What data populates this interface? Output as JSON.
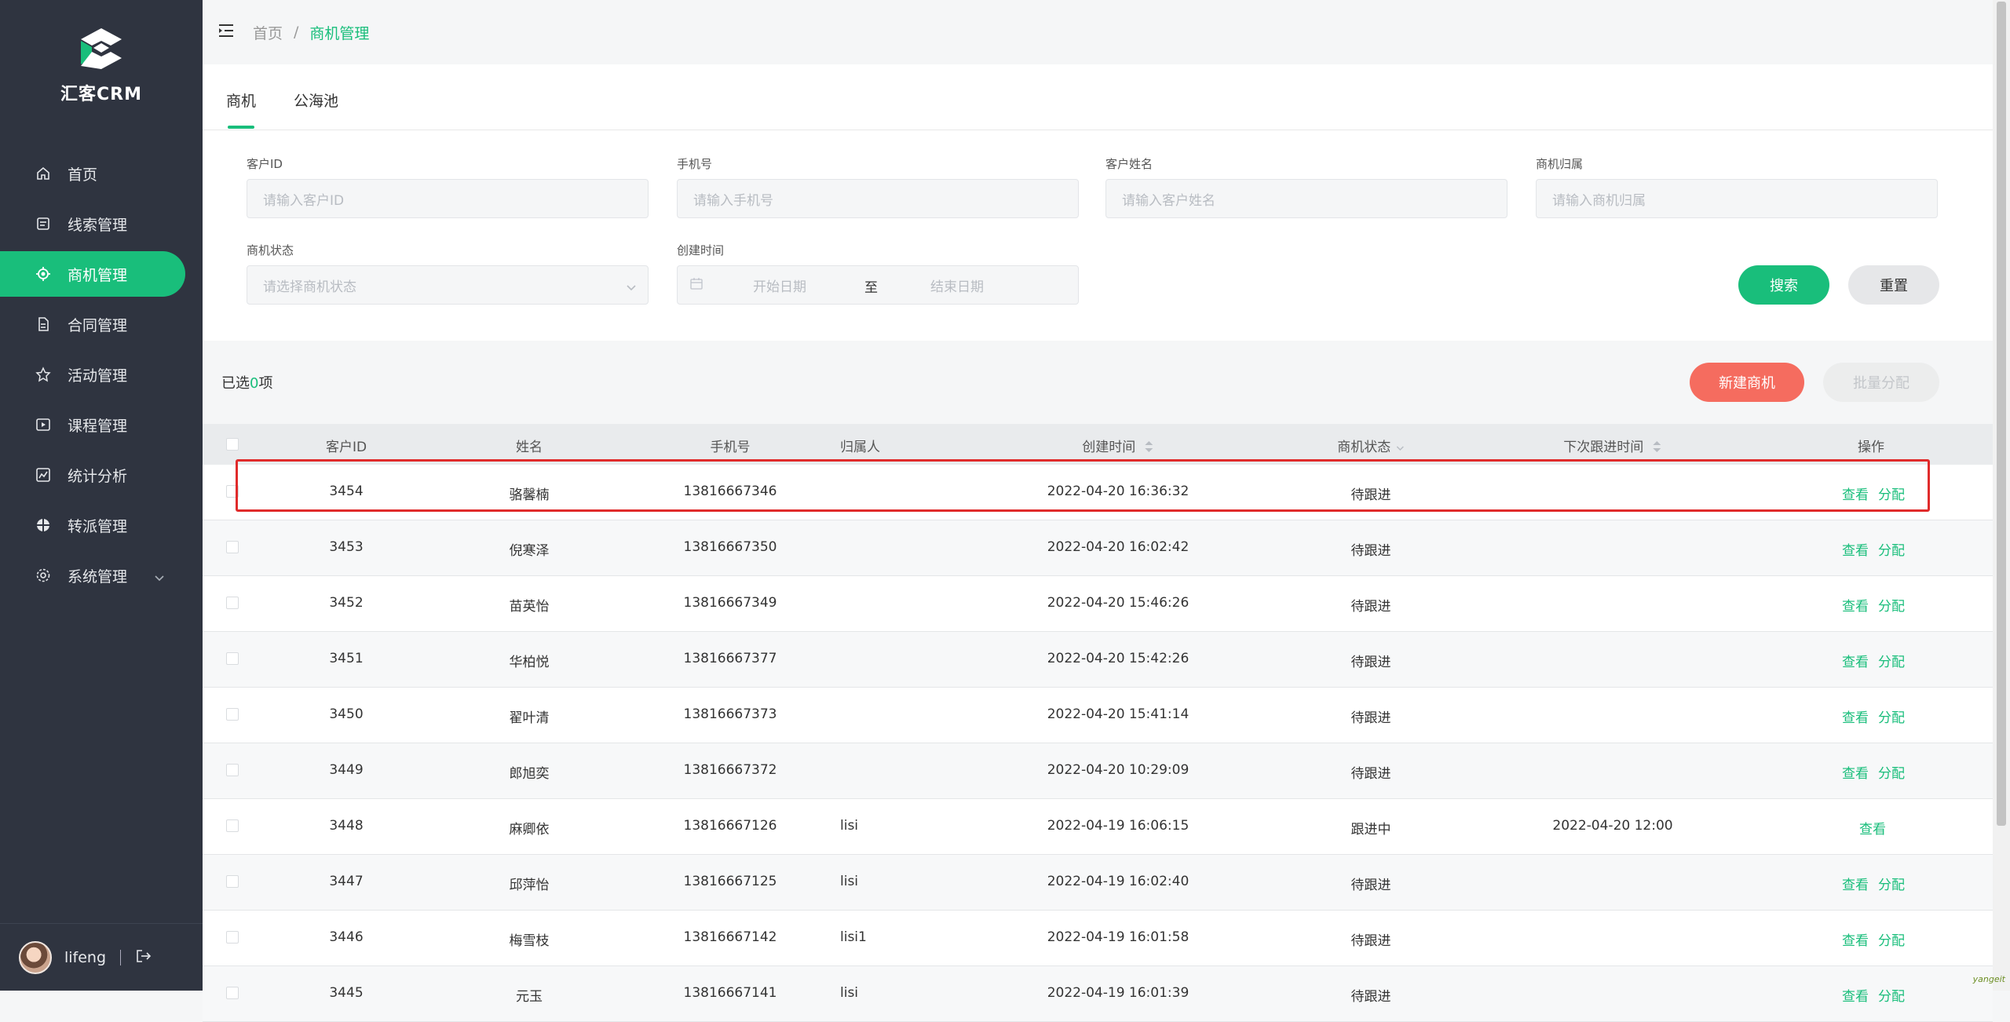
{
  "app": {
    "brand": "汇客CRM"
  },
  "sidebar": {
    "items": [
      {
        "label": "首页",
        "icon": "home-icon"
      },
      {
        "label": "线索管理",
        "icon": "clue-icon"
      },
      {
        "label": "商机管理",
        "icon": "target-icon",
        "active": true
      },
      {
        "label": "合同管理",
        "icon": "contract-icon"
      },
      {
        "label": "活动管理",
        "icon": "star-icon"
      },
      {
        "label": "课程管理",
        "icon": "video-icon"
      },
      {
        "label": "统计分析",
        "icon": "chart-icon"
      },
      {
        "label": "转派管理",
        "icon": "transfer-icon"
      },
      {
        "label": "系统管理",
        "icon": "gear-icon"
      }
    ],
    "user": "lifeng"
  },
  "breadcrumb": {
    "home": "首页",
    "sep": "/",
    "current": "商机管理"
  },
  "tabs": [
    "商机",
    "公海池"
  ],
  "filters": {
    "customer_id": {
      "label": "客户ID",
      "placeholder": "请输入客户ID"
    },
    "phone": {
      "label": "手机号",
      "placeholder": "请输入手机号"
    },
    "name": {
      "label": "客户姓名",
      "placeholder": "请输入客户姓名"
    },
    "owner": {
      "label": "商机归属",
      "placeholder": "请输入商机归属"
    },
    "status": {
      "label": "商机状态",
      "placeholder": "请选择商机状态"
    },
    "created": {
      "label": "创建时间",
      "start": "开始日期",
      "to": "至",
      "end": "结束日期"
    }
  },
  "buttons": {
    "search": "搜索",
    "reset": "重置",
    "create": "新建商机",
    "batch": "批量分配"
  },
  "selection": {
    "prefix": "已选",
    "count": "0",
    "suffix": "项"
  },
  "table": {
    "headers": [
      "客户ID",
      "姓名",
      "手机号",
      "归属人",
      "创建时间",
      "商机状态",
      "下次跟进时间",
      "操作"
    ],
    "actions": {
      "view": "查看",
      "assign": "分配"
    },
    "rows": [
      {
        "id": "3454",
        "name": "骆馨楠",
        "phone": "13816667346",
        "owner": "",
        "created": "2022-04-20 16:36:32",
        "status": "待跟进",
        "next": "",
        "assign": true
      },
      {
        "id": "3453",
        "name": "倪寒泽",
        "phone": "13816667350",
        "owner": "",
        "created": "2022-04-20 16:02:42",
        "status": "待跟进",
        "next": "",
        "assign": true
      },
      {
        "id": "3452",
        "name": "苗英怡",
        "phone": "13816667349",
        "owner": "",
        "created": "2022-04-20 15:46:26",
        "status": "待跟进",
        "next": "",
        "assign": true
      },
      {
        "id": "3451",
        "name": "华柏悦",
        "phone": "13816667377",
        "owner": "",
        "created": "2022-04-20 15:42:26",
        "status": "待跟进",
        "next": "",
        "assign": true
      },
      {
        "id": "3450",
        "name": "翟叶清",
        "phone": "13816667373",
        "owner": "",
        "created": "2022-04-20 15:41:14",
        "status": "待跟进",
        "next": "",
        "assign": true
      },
      {
        "id": "3449",
        "name": "郎旭奕",
        "phone": "13816667372",
        "owner": "",
        "created": "2022-04-20 10:29:09",
        "status": "待跟进",
        "next": "",
        "assign": true
      },
      {
        "id": "3448",
        "name": "麻卿依",
        "phone": "13816667126",
        "owner": "lisi",
        "created": "2022-04-19 16:06:15",
        "status": "跟进中",
        "next": "2022-04-20 12:00",
        "assign": false
      },
      {
        "id": "3447",
        "name": "邱萍怡",
        "phone": "13816667125",
        "owner": "lisi",
        "created": "2022-04-19 16:02:40",
        "status": "待跟进",
        "next": "",
        "assign": true
      },
      {
        "id": "3446",
        "name": "梅雪枝",
        "phone": "13816667142",
        "owner": "lisi1",
        "created": "2022-04-19 16:01:58",
        "status": "待跟进",
        "next": "",
        "assign": true
      },
      {
        "id": "3445",
        "name": "元玉",
        "phone": "13816667141",
        "owner": "lisi",
        "created": "2022-04-19 16:01:39",
        "status": "待跟进",
        "next": "",
        "assign": true
      }
    ]
  },
  "colors": {
    "accent": "#19be7b",
    "sidebar": "#2f3440",
    "danger": "#f56c5f",
    "highlight": "#e02b2b"
  },
  "watermark": "yangeit"
}
